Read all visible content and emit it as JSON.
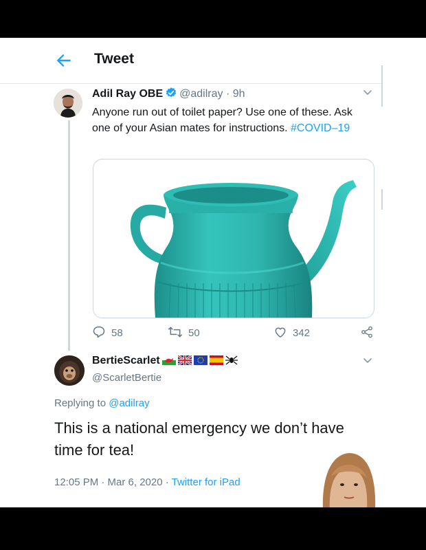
{
  "header": {
    "title": "Tweet"
  },
  "tweet": {
    "author_name": "Adil Ray OBE",
    "handle": "@adilray",
    "time": " · 9h",
    "text": "Anyone run out of toilet paper? Use one of these. Ask one of your Asian mates for instructions. ",
    "hashtag": "#COVID–19",
    "stats": {
      "replies": "58",
      "retweets": "50",
      "likes": "342"
    }
  },
  "reply": {
    "author_name": "BertieScarlet",
    "handle": "@ScarletBertie",
    "replying_prefix": "Replying to ",
    "replying_to": "@adilray",
    "text": "This is a national emergency we don’t have time for tea!",
    "timestamp": "12:05 PM · Mar 6, 2020 · ",
    "source": "Twitter for iPad"
  },
  "colors": {
    "accent": "#1da1f2",
    "muted": "#657786",
    "text": "#14171a",
    "teapot": "#2bb3ad"
  },
  "icons": [
    "back-arrow-icon",
    "verified-badge-icon",
    "chevron-down-icon",
    "reply-icon",
    "retweet-icon",
    "like-icon",
    "share-icon",
    "wales-flag-icon",
    "uk-flag-icon",
    "eu-flag-icon",
    "spain-flag-icon",
    "spider-icon"
  ]
}
